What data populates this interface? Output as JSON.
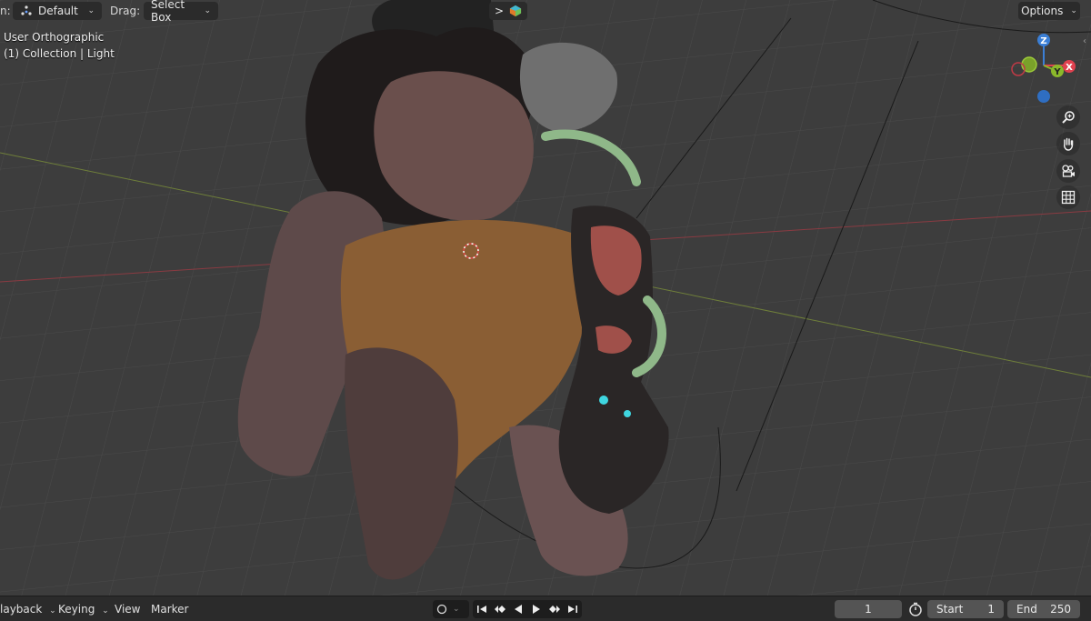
{
  "header": {
    "mode_prefix": "n:",
    "pivot_label": "Default",
    "drag_label": "Drag:",
    "select_label": "Select Box",
    "expand_glyph": ">",
    "options_label": "Options"
  },
  "viewport": {
    "view_name": "User Orthographic",
    "collection_info": "(1) Collection | Light"
  },
  "gizmo": {
    "z_label": "Z",
    "y_label": "Y",
    "x_label": "X",
    "colors": {
      "x": "#e0414f",
      "y": "#8bb82b",
      "z": "#3b7fd6"
    }
  },
  "nav_icons": [
    "zoom-icon",
    "hand-pan-icon",
    "camera-icon",
    "grid-icon"
  ],
  "timeline": {
    "playback_label": "layback",
    "keying_label": "Keying",
    "view_label": "View",
    "marker_label": "Marker",
    "current_frame": "1",
    "start_label": "Start",
    "start_value": "1",
    "end_label": "End",
    "end_value": "250"
  }
}
